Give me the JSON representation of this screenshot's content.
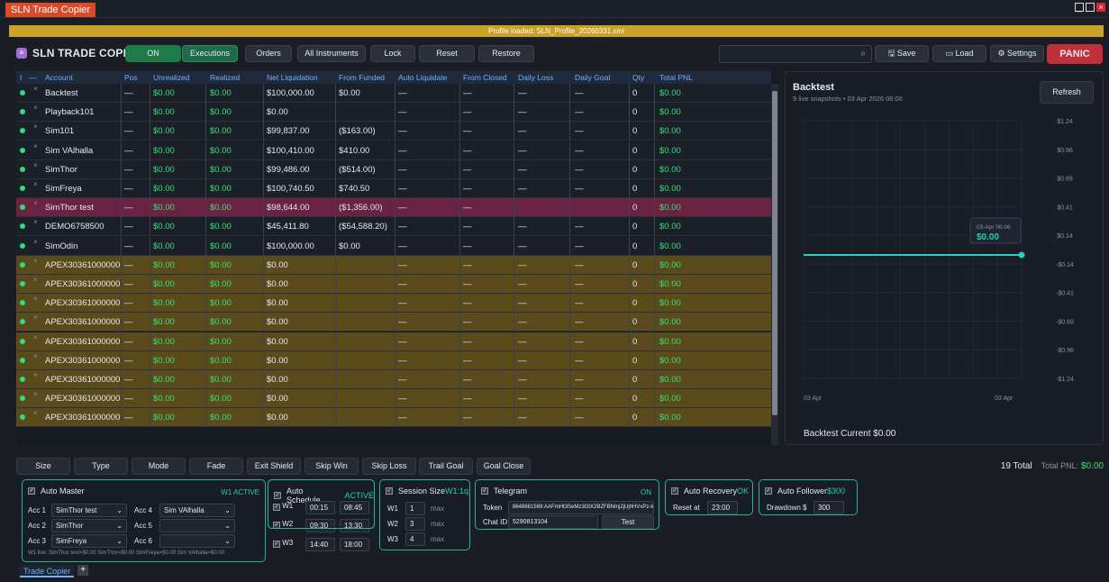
{
  "window": {
    "title": "SLN Trade Copier"
  },
  "banner": "Profile loaded: SLN_Profile_20260331.xml",
  "toolbar": {
    "brand": "SLN TRADE COPIER",
    "buttons": [
      "ON",
      "Executions",
      "Orders",
      "All Instruments",
      "Lock",
      "Reset",
      "Restore"
    ],
    "save": "Save",
    "load": "Load",
    "settings": "Settings",
    "panic": "PANIC"
  },
  "grid": {
    "headers": [
      "Account",
      "Pos",
      "Unrealized",
      "Realized",
      "Net Liquidation",
      "From Funded",
      "Auto Liquidate",
      "From Closed",
      "Daily Loss",
      "Daily Goal",
      "Qty",
      "Total PNL"
    ],
    "rows": [
      {
        "account": "Backtest",
        "pos": "—",
        "unrealized": "$0.00",
        "realized": "$0.00",
        "net": "$100,000.00",
        "funded": "$0.00",
        "auto": "—",
        "closed": "—",
        "loss": "—",
        "goal": "—",
        "qty": "0",
        "total": "$0.00"
      },
      {
        "account": "Playback101",
        "pos": "—",
        "unrealized": "$0.00",
        "realized": "$0.00",
        "net": "$0.00",
        "funded": "",
        "auto": "—",
        "closed": "—",
        "loss": "—",
        "goal": "—",
        "qty": "0",
        "total": "$0.00"
      },
      {
        "account": "Sim101",
        "pos": "—",
        "unrealized": "$0.00",
        "realized": "$0.00",
        "net": "$99,837.00",
        "funded": "($163.00)",
        "auto": "—",
        "closed": "—",
        "loss": "—",
        "goal": "—",
        "qty": "0",
        "total": "$0.00"
      },
      {
        "account": "Sim VAlhalla",
        "pos": "—",
        "unrealized": "$0.00",
        "realized": "$0.00",
        "net": "$100,410.00",
        "funded": "$410.00",
        "auto": "—",
        "closed": "—",
        "loss": "—",
        "goal": "—",
        "qty": "0",
        "total": "$0.00"
      },
      {
        "account": "SimThor",
        "pos": "—",
        "unrealized": "$0.00",
        "realized": "$0.00",
        "net": "$99,486.00",
        "funded": "($514.00)",
        "auto": "—",
        "closed": "—",
        "loss": "—",
        "goal": "—",
        "qty": "0",
        "total": "$0.00"
      },
      {
        "account": "SimFreya",
        "pos": "—",
        "unrealized": "$0.00",
        "realized": "$0.00",
        "net": "$100,740.50",
        "funded": "$740.50",
        "auto": "—",
        "closed": "—",
        "loss": "—",
        "goal": "—",
        "qty": "0",
        "total": "$0.00"
      },
      {
        "account": "SimThor test",
        "pos": "—",
        "unrealized": "$0.00",
        "realized": "$0.00",
        "net": "$98,644.00",
        "funded": "($1,356.00)",
        "auto": "—",
        "closed": "—",
        "loss": "",
        "goal": "",
        "qty": "0",
        "total": "$0.00"
      },
      {
        "account": "DEMO6758500",
        "pos": "—",
        "unrealized": "$0.00",
        "realized": "$0.00",
        "net": "$45,411.80",
        "funded": "($54,588.20)",
        "auto": "—",
        "closed": "—",
        "loss": "—",
        "goal": "—",
        "qty": "0",
        "total": "$0.00"
      },
      {
        "account": "SimOdin",
        "pos": "—",
        "unrealized": "$0.00",
        "realized": "$0.00",
        "net": "$100,000.00",
        "funded": "$0.00",
        "auto": "—",
        "closed": "—",
        "loss": "—",
        "goal": "—",
        "qty": "0",
        "total": "$0.00"
      },
      {
        "account": "APEX30361000000",
        "pos": "—",
        "unrealized": "$0.00",
        "realized": "$0.00",
        "net": "$0.00",
        "funded": "",
        "auto": "—",
        "closed": "—",
        "loss": "—",
        "goal": "—",
        "qty": "0",
        "total": "$0.00"
      },
      {
        "account": "APEX30361000000",
        "pos": "—",
        "unrealized": "$0.00",
        "realized": "$0.00",
        "net": "$0.00",
        "funded": "",
        "auto": "—",
        "closed": "—",
        "loss": "—",
        "goal": "—",
        "qty": "0",
        "total": "$0.00"
      },
      {
        "account": "APEX30361000000",
        "pos": "—",
        "unrealized": "$0.00",
        "realized": "$0.00",
        "net": "$0.00",
        "funded": "",
        "auto": "—",
        "closed": "—",
        "loss": "—",
        "goal": "—",
        "qty": "0",
        "total": "$0.00"
      },
      {
        "account": "APEX30361000000",
        "pos": "—",
        "unrealized": "$0.00",
        "realized": "$0.00",
        "net": "$0.00",
        "funded": "",
        "auto": "—",
        "closed": "—",
        "loss": "—",
        "goal": "—",
        "qty": "0",
        "total": "$0.00"
      },
      {
        "account": "APEX30361000000",
        "pos": "—",
        "unrealized": "$0.00",
        "realized": "$0.00",
        "net": "$0.00",
        "funded": "",
        "auto": "—",
        "closed": "—",
        "loss": "—",
        "goal": "—",
        "qty": "0",
        "total": "$0.00"
      },
      {
        "account": "APEX30361000000",
        "pos": "—",
        "unrealized": "$0.00",
        "realized": "$0.00",
        "net": "$0.00",
        "funded": "",
        "auto": "—",
        "closed": "—",
        "loss": "—",
        "goal": "—",
        "qty": "0",
        "total": "$0.00"
      },
      {
        "account": "APEX30361000000",
        "pos": "—",
        "unrealized": "$0.00",
        "realized": "$0.00",
        "net": "$0.00",
        "funded": "",
        "auto": "—",
        "closed": "—",
        "loss": "—",
        "goal": "—",
        "qty": "0",
        "total": "$0.00"
      },
      {
        "account": "APEX30361000000",
        "pos": "—",
        "unrealized": "$0.00",
        "realized": "$0.00",
        "net": "$0.00",
        "funded": "",
        "auto": "—",
        "closed": "—",
        "loss": "—",
        "goal": "—",
        "qty": "0",
        "total": "$0.00"
      },
      {
        "account": "APEX30361000000",
        "pos": "—",
        "unrealized": "$0.00",
        "realized": "$0.00",
        "net": "$0.00",
        "funded": "",
        "auto": "—",
        "closed": "—",
        "loss": "—",
        "goal": "—",
        "qty": "0",
        "total": "$0.00"
      }
    ]
  },
  "backtest": {
    "title": "Backtest",
    "subtitle": "9 live snapshots • 03 Apr 2026 06:06",
    "refresh": "Refresh",
    "yticks": [
      "$1.24",
      "$0.96",
      "$0.69",
      "$0.41",
      "$0.14",
      "-$0.14",
      "-$0.41",
      "-$0.69",
      "-$0.96",
      "-$1.24"
    ],
    "xticks": [
      "03 Apr",
      "03 Apr"
    ],
    "tooltip_time": "03-Apr 06:06",
    "tooltip_value": "$0.00",
    "current": "Backtest   Current $0.00"
  },
  "bottombar": {
    "buttons": [
      "Size",
      "Type",
      "Mode",
      "Fade",
      "Exit Shield",
      "Skip Win",
      "Skip Loss",
      "Trail Goal",
      "Goal Close"
    ],
    "total": "19 Total",
    "total_pnl_label": "Total PNL:",
    "total_pnl": "$0.00"
  },
  "automaster": {
    "title": "Auto Master",
    "status": "W1 ACTIVE",
    "acc": [
      {
        "l": "Acc 1",
        "v": "SimThor test"
      },
      {
        "l": "Acc 2",
        "v": "SimThor"
      },
      {
        "l": "Acc 3",
        "v": "SimFreya"
      },
      {
        "l": "Acc 4",
        "v": "Sim VAlhalla"
      },
      {
        "l": "Acc 5",
        "v": ""
      },
      {
        "l": "Acc 6",
        "v": ""
      }
    ],
    "live": "W1 live: SimThor test=$0.00  SimThor=$0.00  SimFreya=$0.00  Sim VAlhalla=$0.00"
  },
  "schedule": {
    "title": "Auto Schedule",
    "status": "ACTIVE",
    "rows": [
      {
        "l": "W1",
        "a": "00:15",
        "b": "08:45"
      },
      {
        "l": "W2",
        "a": "09:30",
        "b": "13:30"
      },
      {
        "l": "W3",
        "a": "14:40",
        "b": "18:00"
      }
    ]
  },
  "session": {
    "title": "Session Size",
    "status": "W1:1q",
    "rows": [
      {
        "l": "W1",
        "v": "1",
        "m": "max"
      },
      {
        "l": "W2",
        "v": "3",
        "m": "max"
      },
      {
        "l": "W3",
        "v": "4",
        "m": "max"
      }
    ]
  },
  "telegram": {
    "title": "Telegram",
    "status": "ON",
    "token_label": "Token",
    "token": "8648661569:AAFmHt3SeMz3GtX2BZFBNmj2jUjhHVxPz-k",
    "chat_label": "Chat ID",
    "chat": "5290813104",
    "test": "Test"
  },
  "recovery": {
    "title": "Auto Recovery",
    "status": "OK",
    "reset_label": "Reset at",
    "reset": "23:00"
  },
  "follower": {
    "title": "Auto Follower",
    "status": "$300",
    "dd_label": "Drawdown $",
    "dd": "300"
  },
  "tabs": {
    "active": "Trade Copier",
    "plus": "+"
  }
}
